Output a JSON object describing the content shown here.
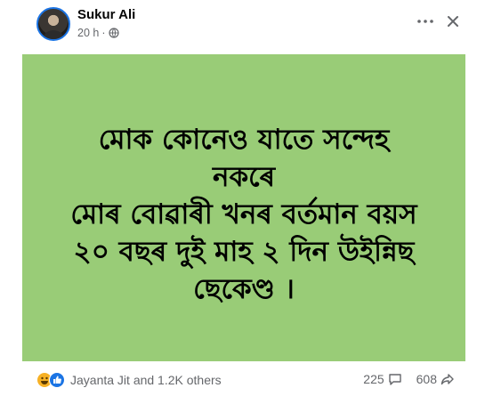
{
  "post": {
    "author": "Sukur Ali",
    "time": "20 h",
    "separator": "·",
    "text_lines": [
      "মোক কোনেও যাতে সন্দেহ",
      "নকৰে",
      "মোৰ বোৱাৰী খনৰ বৰ্তমান বয়স",
      "২০ বছৰ দুই মাহ ২ দিন উইন্নিছ",
      "ছেকেণ্ড ।"
    ],
    "background_color": "#99cc77"
  },
  "footer": {
    "reactions_text": "Jayanta Jit and 1.2K others",
    "comments_count": "225",
    "shares_count": "608"
  },
  "icons": {
    "audience": "globe-icon",
    "more": "more-options-icon",
    "close": "close-icon",
    "reactions": [
      "haha-reaction-icon",
      "like-reaction-icon"
    ],
    "comments": "comment-icon",
    "shares": "share-icon"
  }
}
